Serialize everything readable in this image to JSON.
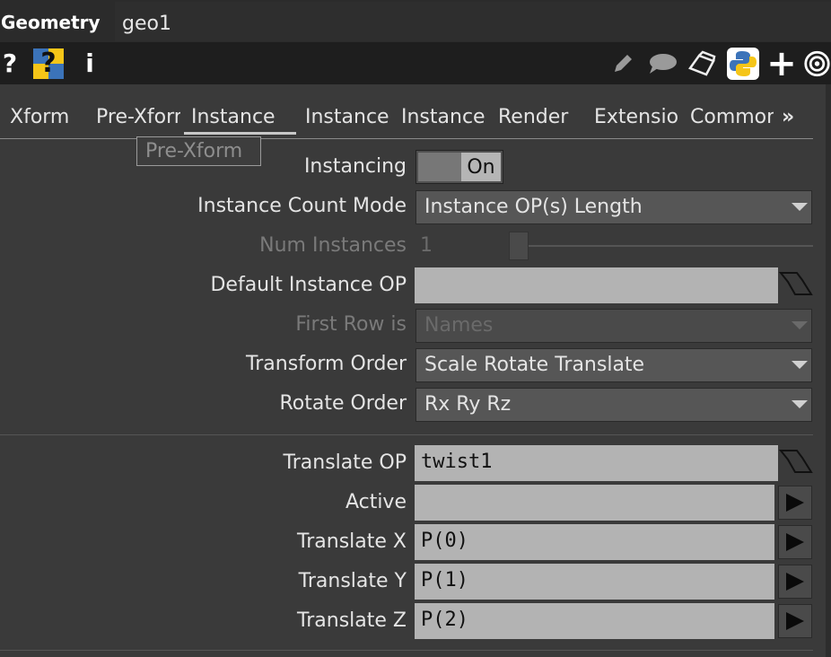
{
  "header": {
    "op_type": "Geometry",
    "op_name": "geo1"
  },
  "toolbar": {
    "left_icons": [
      "help-icon",
      "python-help-icon",
      "info-icon"
    ],
    "right_icons": [
      "edit-icon",
      "comment-icon",
      "clone-icon",
      "python-icon",
      "add-icon",
      "viewer-icon"
    ],
    "help_glyph": "?",
    "help_python_glyph": "?",
    "info_glyph": "i",
    "add_glyph": "+"
  },
  "tabs": [
    {
      "label": "Xform"
    },
    {
      "label": "Pre-Xform"
    },
    {
      "label": "Instance"
    },
    {
      "label": "Instance"
    },
    {
      "label": "Instance"
    },
    {
      "label": "Render"
    },
    {
      "label": "Extensions"
    },
    {
      "label": "Common"
    }
  ],
  "tabs_more": "»",
  "tooltip": "Pre-Xform",
  "params": {
    "instancing": {
      "label": "Instancing",
      "value": "On"
    },
    "count_mode": {
      "label": "Instance Count Mode",
      "value": "Instance OP(s) Length"
    },
    "num_instances": {
      "label": "Num Instances",
      "value": "1"
    },
    "default_op": {
      "label": "Default Instance OP",
      "value": ""
    },
    "first_row": {
      "label": "First Row is",
      "value": "Names"
    },
    "transform_order": {
      "label": "Transform Order",
      "value": "Scale Rotate Translate"
    },
    "rotate_order": {
      "label": "Rotate Order",
      "value": "Rx Ry Rz"
    },
    "translate_op": {
      "label": "Translate OP",
      "value": "twist1"
    },
    "active": {
      "label": "Active",
      "value": ""
    },
    "tx": {
      "label": "Translate X",
      "value": "P(0)"
    },
    "ty": {
      "label": "Translate Y",
      "value": "P(1)"
    },
    "tz": {
      "label": "Translate Z",
      "value": "P(2)"
    }
  },
  "colors": {
    "python_yellow": "#f5c518",
    "python_blue": "#3b73b9",
    "field_bg": "#b3b3b3"
  }
}
